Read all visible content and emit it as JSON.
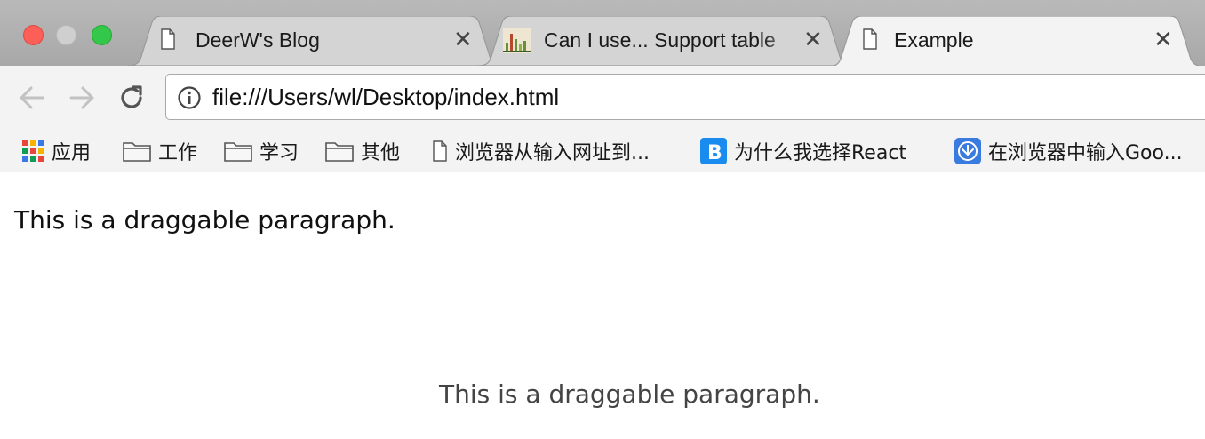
{
  "window": {
    "traffic_lights": [
      "close",
      "minimize",
      "zoom"
    ]
  },
  "tabs": [
    {
      "title": "DeerW's Blog",
      "icon": "page-icon",
      "active": false
    },
    {
      "title": "Can I use... Support table",
      "icon": "caniuse-favicon",
      "active": false
    },
    {
      "title": "Example",
      "icon": "page-icon",
      "active": true
    }
  ],
  "toolbar": {
    "back": "back-arrow-icon",
    "forward": "forward-arrow-icon",
    "reload": "reload-icon",
    "url": "file:///Users/wl/Desktop/index.html"
  },
  "bookmarks": [
    {
      "label": "应用",
      "icon": "apps-grid-icon"
    },
    {
      "label": "工作",
      "icon": "folder-icon"
    },
    {
      "label": "学习",
      "icon": "folder-icon"
    },
    {
      "label": "其他",
      "icon": "folder-icon"
    },
    {
      "label": "浏览器从输入网址到...",
      "icon": "page-icon"
    },
    {
      "label": "为什么我选择React",
      "icon": "b-favicon"
    },
    {
      "label": "在浏览器中输入Goo...",
      "icon": "globe-favicon"
    }
  ],
  "content": {
    "paragraph": "This is a draggable paragraph.",
    "drag_ghost": "This is a draggable paragraph."
  },
  "colors": {
    "tabstrip": "#a8a8a8",
    "active_tab": "#f3f3f3",
    "inactive_tab": "#d4d4d4",
    "traffic_red": "#fc5f57",
    "traffic_green": "#34c84a"
  }
}
